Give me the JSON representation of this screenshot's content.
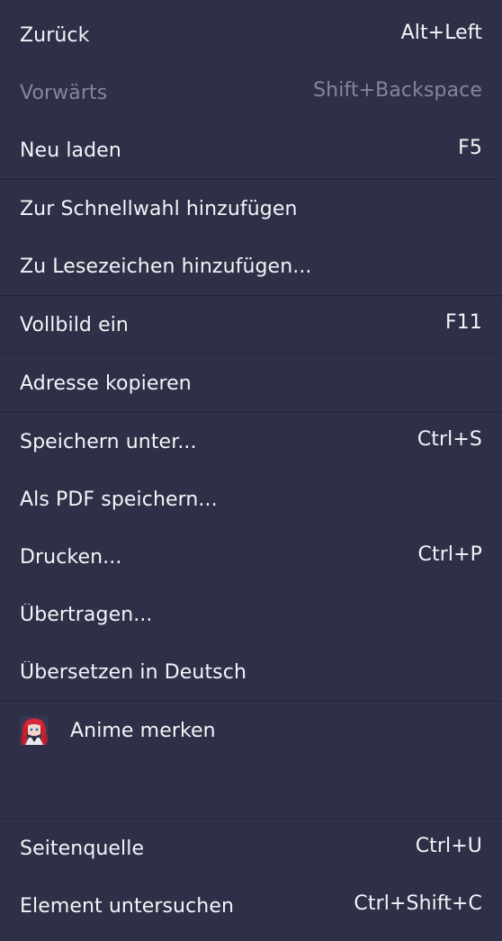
{
  "menu": {
    "back": {
      "label": "Zurück",
      "shortcut": "Alt+Left"
    },
    "forward": {
      "label": "Vorwärts",
      "shortcut": "Shift+Backspace"
    },
    "reload": {
      "label": "Neu laden",
      "shortcut": "F5"
    },
    "add_speed_dial": {
      "label": "Zur Schnellwahl hinzufügen"
    },
    "add_bookmark": {
      "label": "Zu Lesezeichen hinzufügen..."
    },
    "fullscreen": {
      "label": "Vollbild ein",
      "shortcut": "F11"
    },
    "copy_address": {
      "label": "Adresse kopieren"
    },
    "save_as": {
      "label": "Speichern unter...",
      "shortcut": "Ctrl+S"
    },
    "save_pdf": {
      "label": "Als PDF speichern..."
    },
    "print": {
      "label": "Drucken...",
      "shortcut": "Ctrl+P"
    },
    "cast": {
      "label": "Übertragen..."
    },
    "translate": {
      "label": "Übersetzen in Deutsch"
    },
    "anime": {
      "label": "Anime merken",
      "icon": "anime-avatar-icon"
    },
    "view_source": {
      "label": "Seitenquelle",
      "shortcut": "Ctrl+U"
    },
    "inspect": {
      "label": "Element untersuchen",
      "shortcut": "Ctrl+Shift+C"
    }
  },
  "colors": {
    "background": "#2e3047",
    "text": "#f4f4f8",
    "disabled_text": "#84869a",
    "separator": "#222436"
  }
}
